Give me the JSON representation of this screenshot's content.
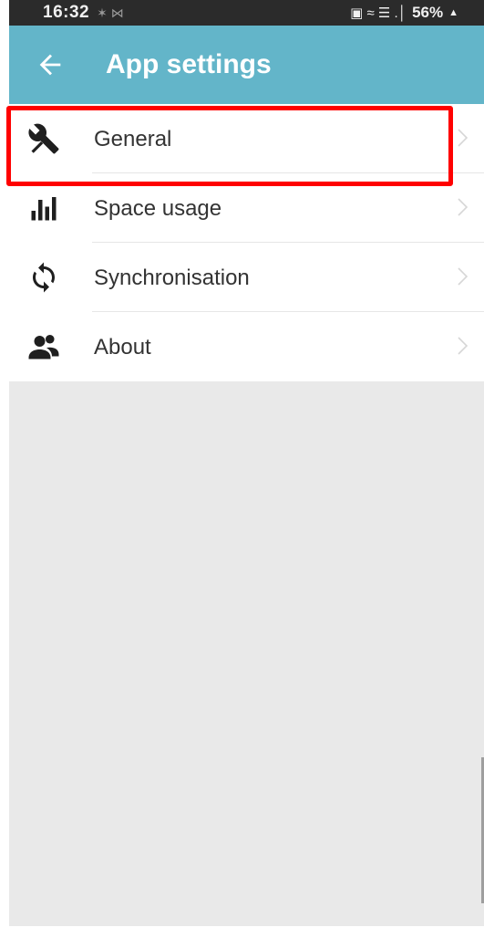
{
  "status_bar": {
    "time": "16:32",
    "notif_icons": "✶ ⋈",
    "right_icons": "▣ ≈ ☰ .│",
    "battery": "56%",
    "lock_glyph": "▲"
  },
  "app_bar": {
    "title": "App settings",
    "background": "#63b5c9"
  },
  "settings": {
    "items": [
      {
        "label": "General",
        "icon": "tools-icon"
      },
      {
        "label": "Space usage",
        "icon": "bar-chart-icon"
      },
      {
        "label": "Synchronisation",
        "icon": "sync-icon"
      },
      {
        "label": "About",
        "icon": "people-icon"
      }
    ]
  },
  "highlight": {
    "color": "#ff0000",
    "target": "General"
  }
}
